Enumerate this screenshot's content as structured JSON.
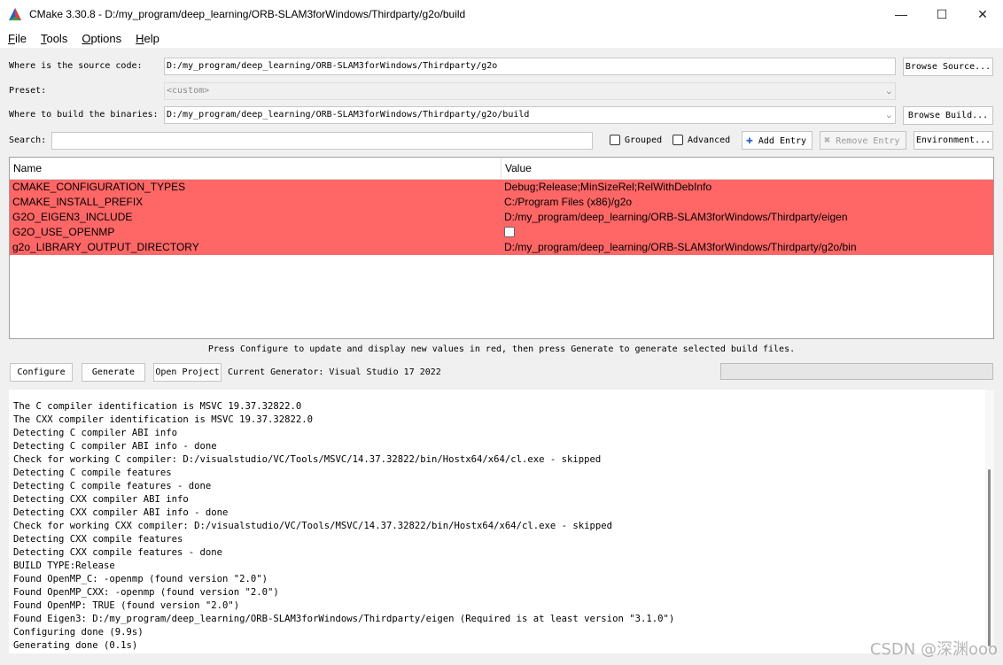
{
  "window": {
    "title": "CMake 3.30.8 - D:/my_program/deep_learning/ORB-SLAM3forWindows/Thirdparty/g2o/build",
    "minimize": "—",
    "maximize": "☐",
    "close": "✕"
  },
  "menu": [
    "File",
    "Tools",
    "Options",
    "Help"
  ],
  "source": {
    "label": "Where is the source code:",
    "value": "D:/my_program/deep_learning/ORB-SLAM3forWindows/Thirdparty/g2o",
    "button": "Browse Source..."
  },
  "preset": {
    "label": "Preset:",
    "value": "<custom>"
  },
  "build": {
    "label": "Where to build the binaries:",
    "value": "D:/my_program/deep_learning/ORB-SLAM3forWindows/Thirdparty/g2o/build",
    "button": "Browse Build..."
  },
  "search": {
    "label": "Search:",
    "value": "",
    "grouped": "Grouped",
    "advanced": "Advanced",
    "add_entry": "Add Entry",
    "remove_entry": "Remove Entry",
    "environment": "Environment..."
  },
  "table": {
    "headers": {
      "name": "Name",
      "value": "Value"
    },
    "rows": [
      {
        "name": "CMAKE_CONFIGURATION_TYPES",
        "value": "Debug;Release;MinSizeRel;RelWithDebInfo"
      },
      {
        "name": "CMAKE_INSTALL_PREFIX",
        "value": "C:/Program Files (x86)/g2o"
      },
      {
        "name": "G2O_EIGEN3_INCLUDE",
        "value": "D:/my_program/deep_learning/ORB-SLAM3forWindows/Thirdparty/eigen"
      },
      {
        "name": "G2O_USE_OPENMP",
        "value": ""
      },
      {
        "name": "g2o_LIBRARY_OUTPUT_DIRECTORY",
        "value": "D:/my_program/deep_learning/ORB-SLAM3forWindows/Thirdparty/g2o/bin"
      }
    ],
    "row_color": "#ff6666"
  },
  "hint": "Press Configure to update and display new values in red, then press Generate to generate selected build files.",
  "actions": {
    "configure": "Configure",
    "generate": "Generate",
    "open_project": "Open Project",
    "generator": "Current Generator: Visual Studio 17 2022"
  },
  "log": [
    "The C compiler identification is MSVC 19.37.32822.0",
    "The CXX compiler identification is MSVC 19.37.32822.0",
    "Detecting C compiler ABI info",
    "Detecting C compiler ABI info - done",
    "Check for working C compiler: D:/visualstudio/VC/Tools/MSVC/14.37.32822/bin/Hostx64/x64/cl.exe - skipped",
    "Detecting C compile features",
    "Detecting C compile features - done",
    "Detecting CXX compiler ABI info",
    "Detecting CXX compiler ABI info - done",
    "Check for working CXX compiler: D:/visualstudio/VC/Tools/MSVC/14.37.32822/bin/Hostx64/x64/cl.exe - skipped",
    "Detecting CXX compile features",
    "Detecting CXX compile features - done",
    "BUILD TYPE:Release",
    "Found OpenMP_C: -openmp (found version \"2.0\")",
    "Found OpenMP_CXX: -openmp (found version \"2.0\")",
    "Found OpenMP: TRUE (found version \"2.0\")",
    "Found Eigen3: D:/my_program/deep_learning/ORB-SLAM3forWindows/Thirdparty/eigen (Required is at least version \"3.1.0\")",
    "Configuring done (9.9s)",
    "Generating done (0.1s)"
  ],
  "watermark": "CSDN @深渊ooo"
}
